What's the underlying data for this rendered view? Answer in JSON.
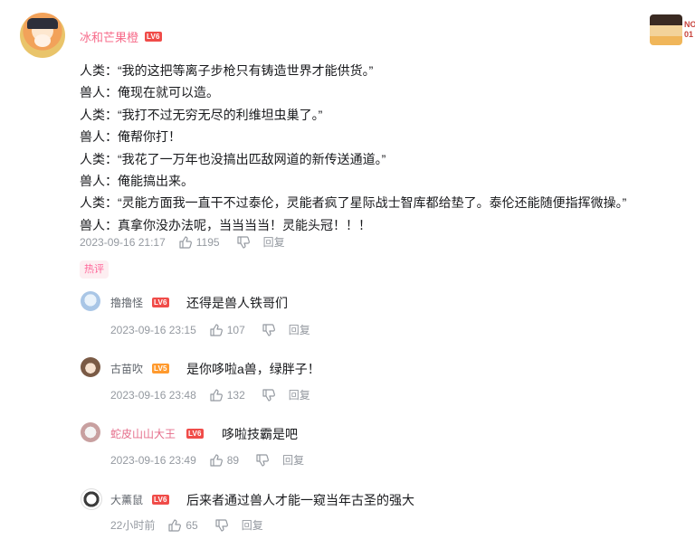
{
  "main_comment": {
    "username": "冰和芒果橙",
    "level": "LV6",
    "lines": [
      "人类：“我的这把等离子步枪只有铸造世界才能供货。”",
      "兽人：俺现在就可以造。",
      "人类：“我打不过无穷无尽的利维坦虫巢了。”",
      "兽人：俺帮你打！",
      "人类：“我花了一万年也没搞出匹敌网道的新传送通道。”",
      "兽人：俺能搞出来。",
      "人类：“灵能方面我一直干不过泰伦，灵能者疯了星际战士智库都给垫了。泰伦还能随便指挥微操。”",
      "兽人：真拿你没办法呢，当当当当！灵能头冠！！！"
    ],
    "date": "2023-09-16 21:17",
    "likes": "1195",
    "reply_label": "回复"
  },
  "corner": {
    "badge_text_1": "NO",
    "badge_text_2": "01"
  },
  "hot_tag": "热评",
  "replies": [
    {
      "username": "撸撸怪",
      "level": "LV6",
      "text": "还得是兽人铁哥们",
      "date": "2023-09-16 23:15",
      "likes": "107",
      "reply_label": "回复"
    },
    {
      "username": "古苗吹",
      "level": "LV5",
      "text": "是你哆啦a兽，绿胖子！",
      "date": "2023-09-16 23:48",
      "likes": "132",
      "reply_label": "回复"
    },
    {
      "username": "蛇皮山山大王",
      "level": "LV6",
      "text": "哆啦技霸是吧",
      "date": "2023-09-16 23:49",
      "likes": "89",
      "reply_label": "回复"
    },
    {
      "username": "大薰鼠",
      "level": "LV6",
      "text": "后来者通过兽人才能一窥当年古圣的强大",
      "date": "22小时前",
      "likes": "65",
      "reply_label": "回复"
    }
  ],
  "colors": {
    "vip_name": "#f76b8a",
    "level_lv6": "#f04c49",
    "level_lv5": "#ff9a2e",
    "meta": "#9499a0",
    "hot_tag_bg": "#fdeef1",
    "hot_tag_text": "#ff6699"
  }
}
